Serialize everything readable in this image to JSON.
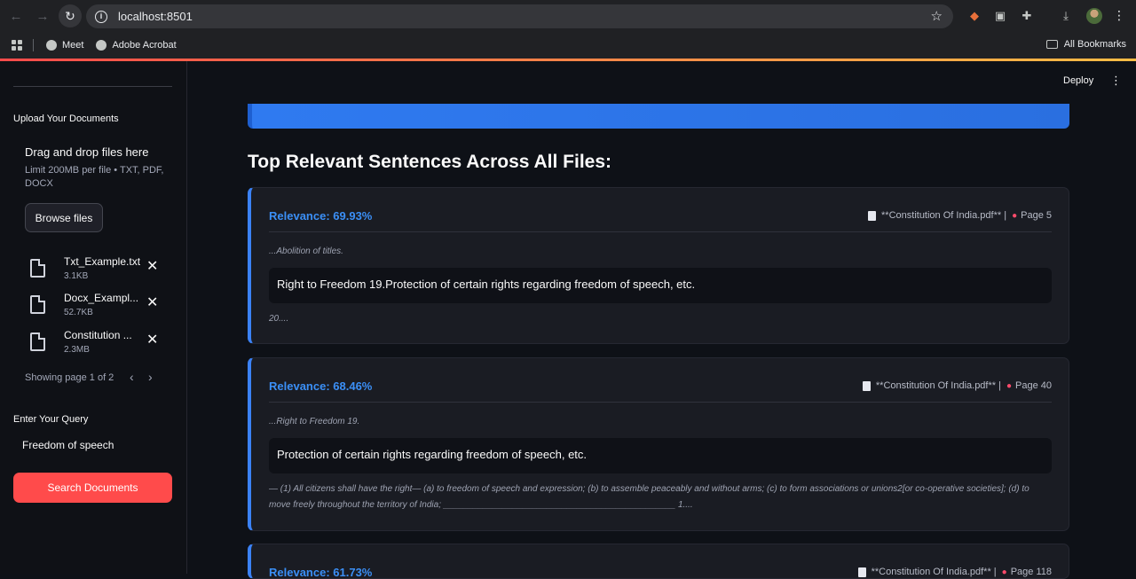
{
  "browser": {
    "url": "localhost:8501",
    "bookmarks": [
      "Meet",
      "Adobe Acrobat"
    ],
    "all_bookmarks": "All Bookmarks"
  },
  "sidebar": {
    "upload_label": "Upload Your Documents",
    "drop_title": "Drag and drop files here",
    "drop_limit": "Limit 200MB per file • TXT, PDF, DOCX",
    "browse_label": "Browse files",
    "files": [
      {
        "name": "Txt_Example.txt",
        "size": "3.1KB"
      },
      {
        "name": "Docx_Exampl...",
        "size": "52.7KB"
      },
      {
        "name": "Constitution ...",
        "size": "2.3MB"
      }
    ],
    "pager_text": "Showing page 1 of 2",
    "query_label": "Enter Your Query",
    "query_value": "Freedom of speech",
    "search_label": "Search Documents"
  },
  "header": {
    "deploy_label": "Deploy"
  },
  "main": {
    "heading": "Top Relevant Sentences Across All Files:",
    "results": [
      {
        "relevance": "Relevance: 69.93%",
        "source": "**Constitution Of India.pdf** |",
        "page": "Page 5",
        "before": "...Abolition of titles.",
        "sentence": "Right to Freedom 19.Protection of certain rights regarding freedom of speech, etc.",
        "after": "20...."
      },
      {
        "relevance": "Relevance: 68.46%",
        "source": "**Constitution Of India.pdf** |",
        "page": "Page 40",
        "before": "...Right to Freedom 19.",
        "sentence": "Protection of certain rights regarding freedom of speech, etc.",
        "after": "— (1) All citizens shall have the right— (a) to freedom of speech and expression; (b) to assemble peaceably and without arms; (c) to form associations or unions2[or co-operative societies]; (d) to move freely throughout the territory of India; _______________________________________________ 1...."
      },
      {
        "relevance": "Relevance: 61.73%",
        "source": "**Constitution Of India.pdf** |",
        "page": "Page 118",
        "before": "",
        "sentence": "",
        "after": ""
      }
    ]
  },
  "colors": {
    "accent": "#ff4b4b",
    "relevance": "#3b8ff6",
    "card_border": "#3b82f6"
  }
}
